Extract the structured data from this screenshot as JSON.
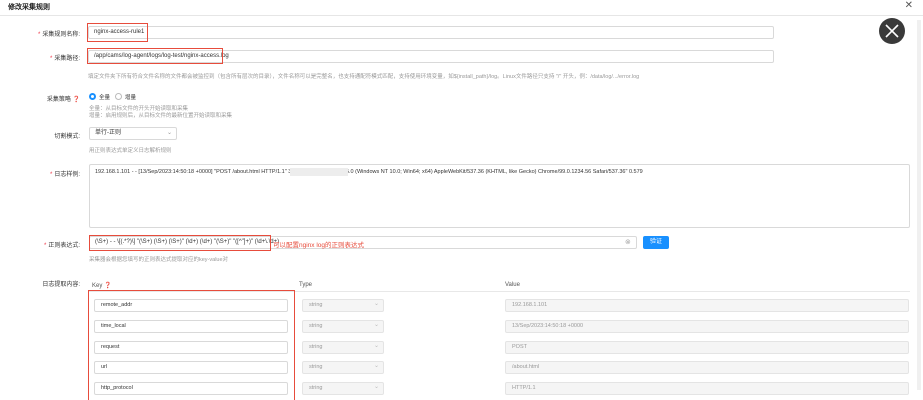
{
  "dialog": {
    "title": "修改采集规则"
  },
  "fields": {
    "rule_name": {
      "label": "采集规则名称:",
      "value": "nginx-access-rule1"
    },
    "path": {
      "label": "采集路径:",
      "value": "/app/cams/log-agent/logs/log-test/nginx-access.log",
      "hint": "填定文件夹下所有符合文件名称的文件都会被监控到（包含所有层次的目录），文件名称可以是完整名，也支持通配符模式匹配，支持使用环境变量，如${install_path}/log。Linux文件路径只支持 \"/\" 开头，例：/data/log/.../error.log"
    },
    "strategy": {
      "label": "采集策略",
      "options": [
        "全量",
        "增量"
      ],
      "hint1": "全量：从目标文件的开头开始读取和采集",
      "hint2": "增量：启用规则后，从目标文件的最新位置开始读取和采集"
    },
    "mode": {
      "label": "切割模式:",
      "value": "单行-正则",
      "hint": "用正则表达式单定义日志解析规则"
    },
    "sample": {
      "label": "日志样例:",
      "value": "192.168.1.101 - - [13/Sep/2023:14:50:18 +0000] \"POST /about.html HTTP/1.1\" 302 8                          ./page1\" \"Mozilla/5.0 (Windows NT 10.0; Win64; x64) AppleWebKit/537.36 (KHTML, like Gecko) Chrome/99.0.1234.56 Safari/537.36\" 0.579"
    },
    "regex": {
      "label": "正则表达式:",
      "value": "(\\S+) - - \\[(.*?)\\] \"(\\S+) (\\S+) (\\S+)\" (\\d+) (\\d+) \"(\\S+)\" \"([^\"]+)\" (\\d+\\.\\d+)",
      "annotation": "可以配置nginx log的正则表达式",
      "verify_label": "验证",
      "hint": "采集器会根据您填写的正则表达式提取对应的key-value对"
    },
    "extract": {
      "label": "日志提取内容:"
    }
  },
  "table": {
    "headers": {
      "key": "Key",
      "type": "Type",
      "value": "Value"
    },
    "rows": [
      {
        "key": "remote_addr",
        "type": "string",
        "value": "192.168.1.101"
      },
      {
        "key": "time_local",
        "type": "string",
        "value": "13/Sep/2023:14:50:18 +0000"
      },
      {
        "key": "request",
        "type": "string",
        "value": "POST"
      },
      {
        "key": "url",
        "type": "string",
        "value": "/about.html"
      },
      {
        "key": "http_protocol",
        "type": "string",
        "value": "HTTP/1.1"
      }
    ]
  },
  "colors": {
    "accent": "#1890ff",
    "highlight": "#e74c3c"
  }
}
